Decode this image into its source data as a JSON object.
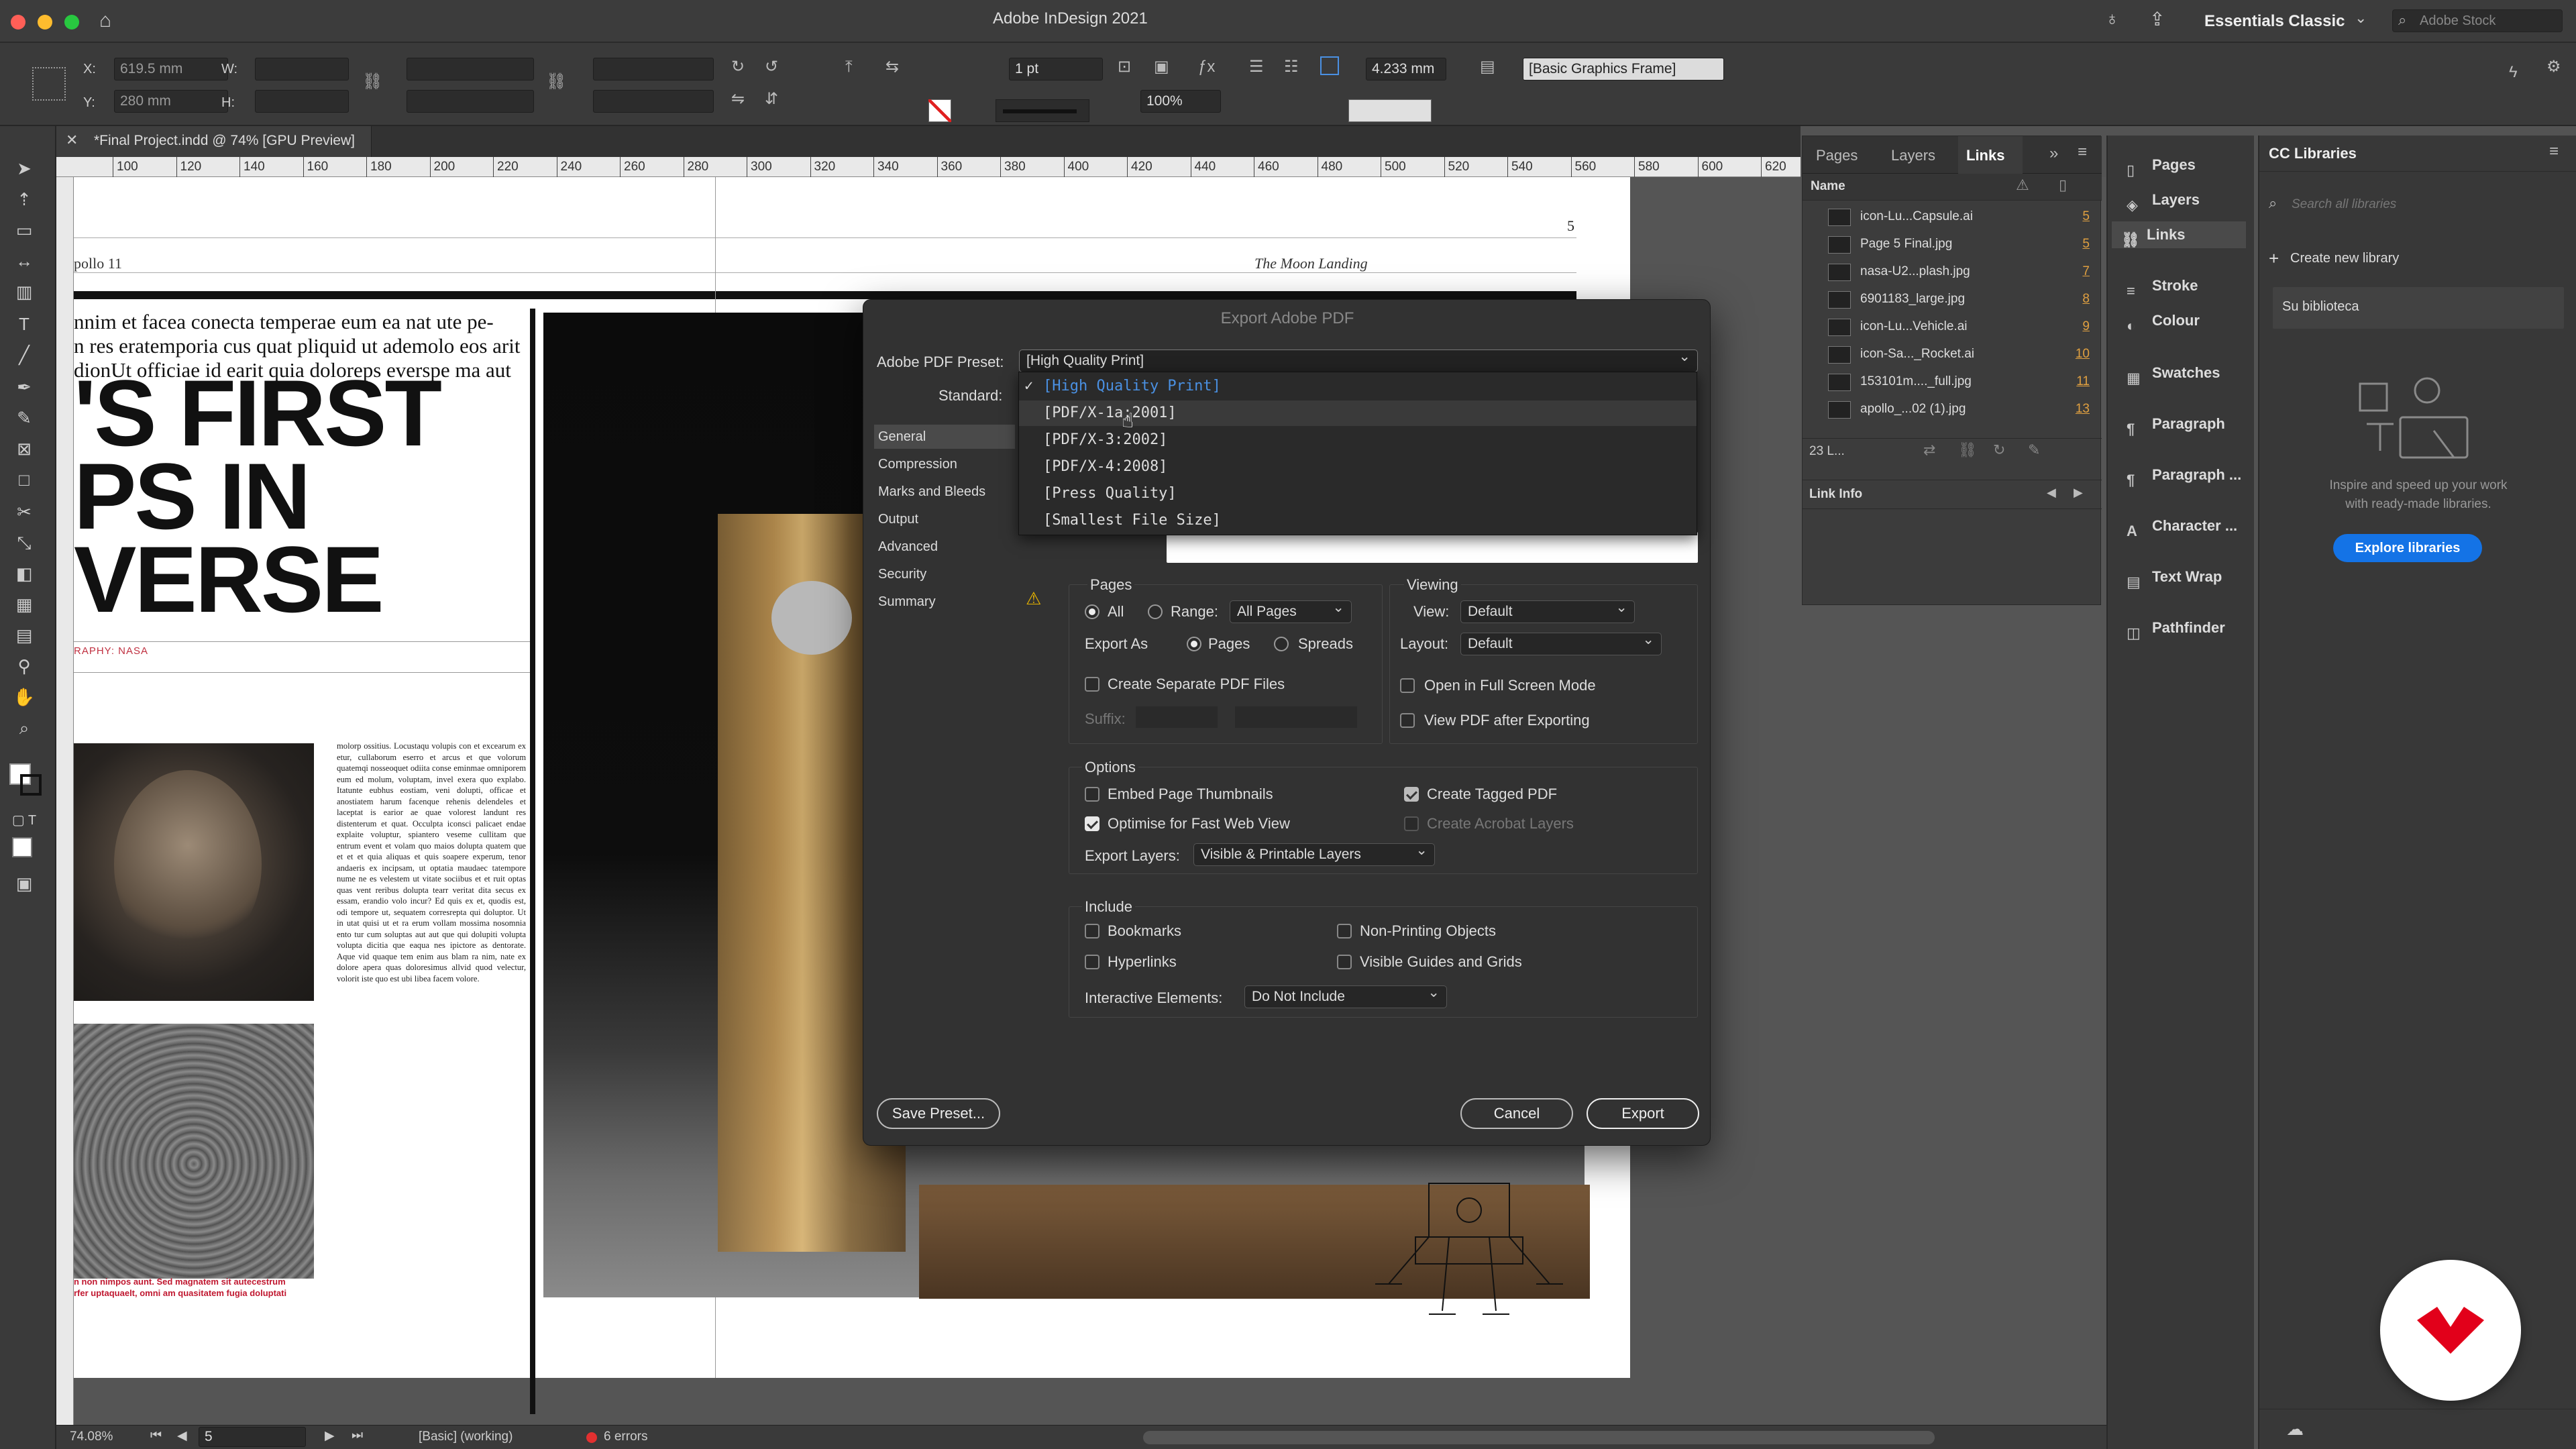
{
  "window": {
    "title": "Adobe InDesign 2021",
    "workspace": "Essentials Classic",
    "stock_search_placeholder": "Adobe Stock"
  },
  "control": {
    "x_label": "X:",
    "x_value": "619.5 mm",
    "y_label": "Y:",
    "y_value": "280 mm",
    "w_label": "W:",
    "h_label": "H:",
    "stroke_weight": "1 pt",
    "scale": "100%",
    "spacing": "4.233 mm",
    "object_style": "[Basic Graphics Frame]"
  },
  "document": {
    "tab": "*Final Project.indd @ 74% [GPU Preview]",
    "ruler_ticks": [
      "100",
      "120",
      "140",
      "160",
      "180",
      "200",
      "220",
      "240",
      "260",
      "280",
      "300",
      "320",
      "340",
      "360",
      "380",
      "400",
      "420",
      "440",
      "460",
      "480",
      "500",
      "520",
      "540",
      "560",
      "580",
      "600",
      "620"
    ],
    "page_number": "5",
    "running_left": "pollo 11",
    "running_right": "The Moon Landing",
    "intro": [
      "nnim et facea conecta temperae eum ea nat ute pe-",
      "n res eratemporia cus quat pliquid ut ademolo eos arit",
      "dionUt officiae id earit quia doloreps everspe ma aut"
    ],
    "headline": [
      "'S FIRST",
      "PS IN",
      "VERSE"
    ],
    "credit": "RAPHY: NASA",
    "caption": [
      "n non nimpos aunt. Sed magnatem sit autecestrum",
      "rfer uptaquaelt, omni am quasitatem fugia doluptati"
    ],
    "body_text": "molorp ossitius. Locustaqu volupis con et excearum ex etur, cullaborum eserro et arcus et que volorum quatemqi nosseoquet odiita conse eminmae omniporem eum ed molum, voluptam, invel exera quo explabo. Itatunte eubhus eostiam, veni dolupti, officae et anostiatem harum facenque rehenis delendeles et laceptat is earior ae quae volorest landunt res distenterum et quat. Occulpta iconsci palicaet endae explaite voluptur, spiantero veseme cullitam que entrum event et volam quo maios dolupta quatem que et et et quia aliquas et quis soapere experum, tenor andaeris ex incipsam, ut optatia maudaec tatempore nume ne es velestem ut vitate sociibus et et ruit optas quas vent reribus dolupta tearr veritat dita secus ex essam, erandio volo incur? Ed quis ex et, quodis est, odi tempore ut, sequatem corresrepta qui doluptor. Ut in utat quisi ut et ra erum vollam mossima nosomnia ento tur cum soluptas aut aut que qui dolupiti volupta volupta dicitia que eaqua nes ipictore as dentorate. Aque vid quaque tem enim aus blam ra nim, nate ex dolore apera quas doloresimus allvid quod velectur, volorit iste quo est ubi libea facem volore.",
    "zoom": "74.08%",
    "page_field": "5",
    "preflight_profile": "[Basic] (working)",
    "errors": "6 errors"
  },
  "panel_links": {
    "tabs": [
      "Pages",
      "Layers",
      "Links"
    ],
    "column": "Name",
    "items": [
      {
        "name": "icon-Lu...Capsule.ai",
        "page": "5"
      },
      {
        "name": "Page 5 Final.jpg",
        "page": "5"
      },
      {
        "name": "nasa-U2...plash.jpg",
        "page": "7"
      },
      {
        "name": "6901183_large.jpg",
        "page": "8"
      },
      {
        "name": "icon-Lu...Vehicle.ai",
        "page": "9"
      },
      {
        "name": "icon-Sa..._Rocket.ai",
        "page": "10"
      },
      {
        "name": "153101m...._full.jpg",
        "page": "11"
      },
      {
        "name": "apollo_...02 (1).jpg",
        "page": "13"
      }
    ],
    "count": "23 L...",
    "link_info": "Link Info"
  },
  "panel_dock": {
    "items": [
      {
        "label": "Pages",
        "icon": "pages-icon"
      },
      {
        "label": "Layers",
        "icon": "layers-icon"
      },
      {
        "label": "Links",
        "icon": "links-icon"
      },
      {
        "label": "Stroke",
        "icon": "stroke-icon"
      },
      {
        "label": "Colour",
        "icon": "colour-icon"
      },
      {
        "label": "Swatches",
        "icon": "swatches-icon"
      },
      {
        "label": "Paragraph",
        "icon": "paragraph-icon"
      },
      {
        "label": "Paragraph ...",
        "icon": "paragraph-styles-icon"
      },
      {
        "label": "Character ...",
        "icon": "character-styles-icon"
      },
      {
        "label": "Text Wrap",
        "icon": "text-wrap-icon"
      },
      {
        "label": "Pathfinder",
        "icon": "pathfinder-icon"
      }
    ]
  },
  "cc_libraries": {
    "title": "CC Libraries",
    "search_placeholder": "Search all libraries",
    "create": "Create new library",
    "library": "Su biblioteca",
    "promo": [
      "Inspire and speed up your work",
      "with ready-made libraries."
    ],
    "explore": "Explore libraries"
  },
  "dialog": {
    "title": "Export Adobe PDF",
    "preset_label": "Adobe PDF Preset:",
    "preset_value": "[High Quality Print]",
    "standard_label": "Standard:",
    "preset_options": [
      "[High Quality Print]",
      "[PDF/X-1a:2001]",
      "[PDF/X-3:2002]",
      "[PDF/X-4:2008]",
      "[Press Quality]",
      "[Smallest File Size]"
    ],
    "nav": [
      "General",
      "Compression",
      "Marks and Bleeds",
      "Output",
      "Advanced",
      "Security",
      "Summary"
    ],
    "pages": {
      "legend": "Pages",
      "all": "All",
      "range": "Range:",
      "range_value": "All Pages",
      "export_as": "Export As",
      "pages_opt": "Pages",
      "spreads_opt": "Spreads",
      "separate": "Create Separate PDF Files",
      "suffix": "Suffix:"
    },
    "viewing": {
      "legend": "Viewing",
      "view": "View:",
      "view_value": "Default",
      "layout": "Layout:",
      "layout_value": "Default",
      "fullscreen": "Open in Full Screen Mode",
      "view_after": "View PDF after Exporting"
    },
    "options": {
      "legend": "Options",
      "thumbnails": "Embed Page Thumbnails",
      "fastweb": "Optimise for Fast Web View",
      "tagged": "Create Tagged PDF",
      "acrobat_layers": "Create Acrobat Layers",
      "export_layers": "Export Layers:",
      "export_layers_value": "Visible & Printable Layers"
    },
    "include": {
      "legend": "Include",
      "bookmarks": "Bookmarks",
      "hyperlinks": "Hyperlinks",
      "nonprinting": "Non-Printing Objects",
      "guides": "Visible Guides and Grids",
      "interactive": "Interactive Elements:",
      "interactive_value": "Do Not Include"
    },
    "save_preset": "Save Preset...",
    "cancel": "Cancel",
    "export": "Export"
  },
  "colors": {
    "accent": "#1473e6",
    "highlight": "#4a90e2",
    "link_page": "#e0a040",
    "brand_red": "#e2001a"
  }
}
